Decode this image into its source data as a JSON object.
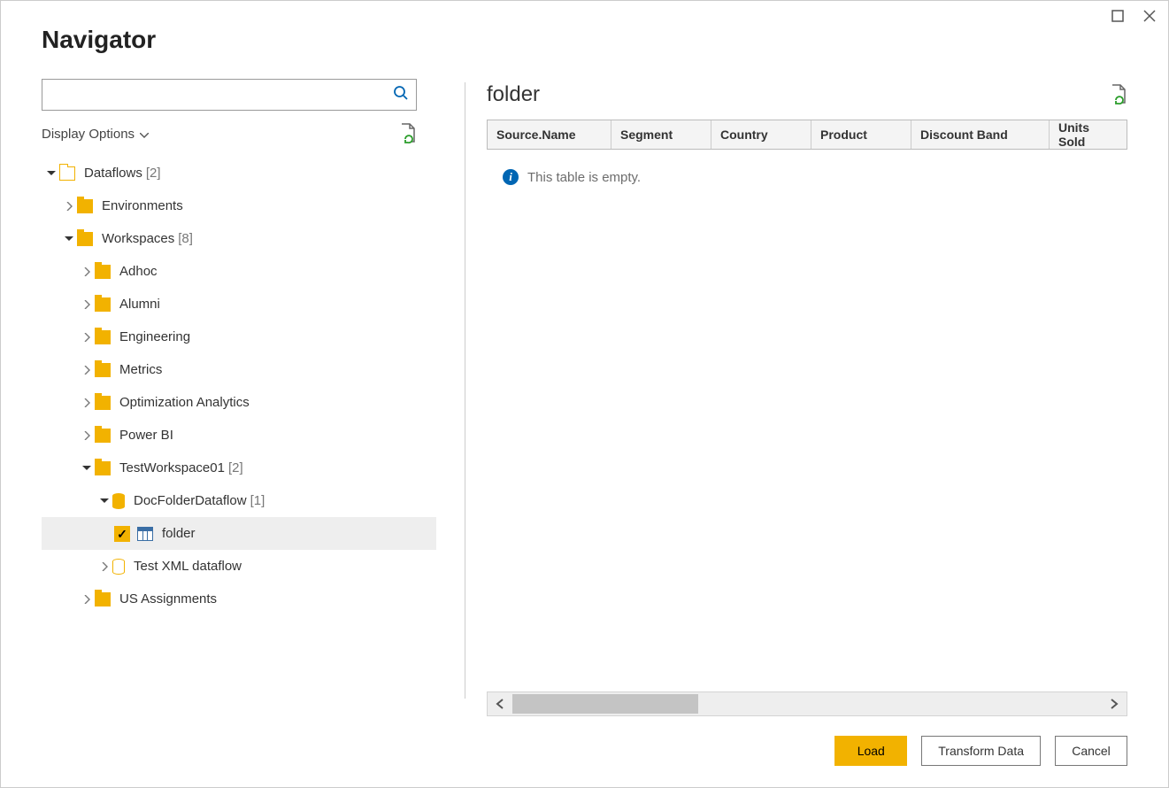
{
  "window": {
    "title": "Navigator"
  },
  "search": {
    "placeholder": ""
  },
  "display_options_label": "Display Options",
  "tree": {
    "root": {
      "label": "Dataflows",
      "count": "[2]"
    },
    "environments": {
      "label": "Environments"
    },
    "workspaces": {
      "label": "Workspaces",
      "count": "[8]"
    },
    "adhoc": {
      "label": "Adhoc"
    },
    "alumni": {
      "label": "Alumni"
    },
    "engineering": {
      "label": "Engineering"
    },
    "metrics": {
      "label": "Metrics"
    },
    "optimization": {
      "label": "Optimization Analytics"
    },
    "powerbi": {
      "label": "Power BI"
    },
    "testws": {
      "label": "TestWorkspace01",
      "count": "[2]"
    },
    "docfolder": {
      "label": "DocFolderDataflow",
      "count": "[1]"
    },
    "folder_item": {
      "label": "folder"
    },
    "testxml": {
      "label": "Test XML dataflow"
    },
    "usassign": {
      "label": "US Assignments"
    }
  },
  "preview": {
    "title": "folder",
    "columns": {
      "c0": "Source.Name",
      "c1": "Segment",
      "c2": "Country",
      "c3": "Product",
      "c4": "Discount Band",
      "c5": "Units Sold"
    },
    "empty_message": "This table is empty."
  },
  "buttons": {
    "load": "Load",
    "transform": "Transform Data",
    "cancel": "Cancel"
  }
}
